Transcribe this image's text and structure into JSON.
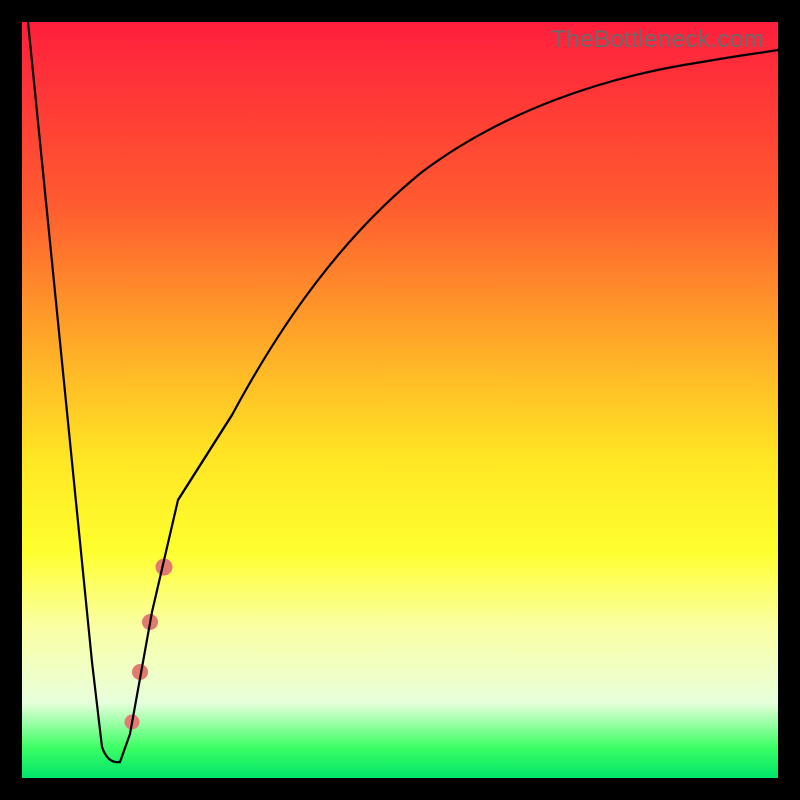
{
  "watermark": "TheBottleneck.com",
  "chart_data": {
    "type": "line",
    "title": "",
    "xlabel": "",
    "ylabel": "",
    "xlim": [
      0,
      100
    ],
    "ylim": [
      0,
      100
    ],
    "grid": false,
    "legend": false,
    "background": "vertical-gradient-red-orange-yellow-green",
    "series": [
      {
        "name": "bottleneck-curve",
        "x": [
          0,
          3,
          6,
          8,
          10,
          11,
          12,
          14,
          16,
          18,
          20,
          23,
          27,
          32,
          38,
          45,
          55,
          70,
          85,
          100
        ],
        "y": [
          100,
          70,
          40,
          15,
          3,
          2,
          2,
          3,
          10,
          22,
          35,
          50,
          62,
          72,
          80,
          86,
          90,
          93,
          95,
          96
        ]
      }
    ],
    "highlights": {
      "band": {
        "x_range": [
          20,
          27
        ],
        "comment": "salmon thick segment along rising curve"
      },
      "dots": [
        {
          "x": 18,
          "y": 22
        },
        {
          "x": 16,
          "y": 13
        },
        {
          "x": 15,
          "y": 8
        },
        {
          "x": 14,
          "y": 4
        }
      ]
    },
    "colors": {
      "curve": "#000000",
      "highlight": "#e37a70",
      "gradient_stops": [
        "#ff1e3c",
        "#ff5e2f",
        "#ffb427",
        "#ffe724",
        "#feff2e",
        "#faffa4",
        "#e8ffdc",
        "#3cff64",
        "#00e46a"
      ]
    }
  }
}
